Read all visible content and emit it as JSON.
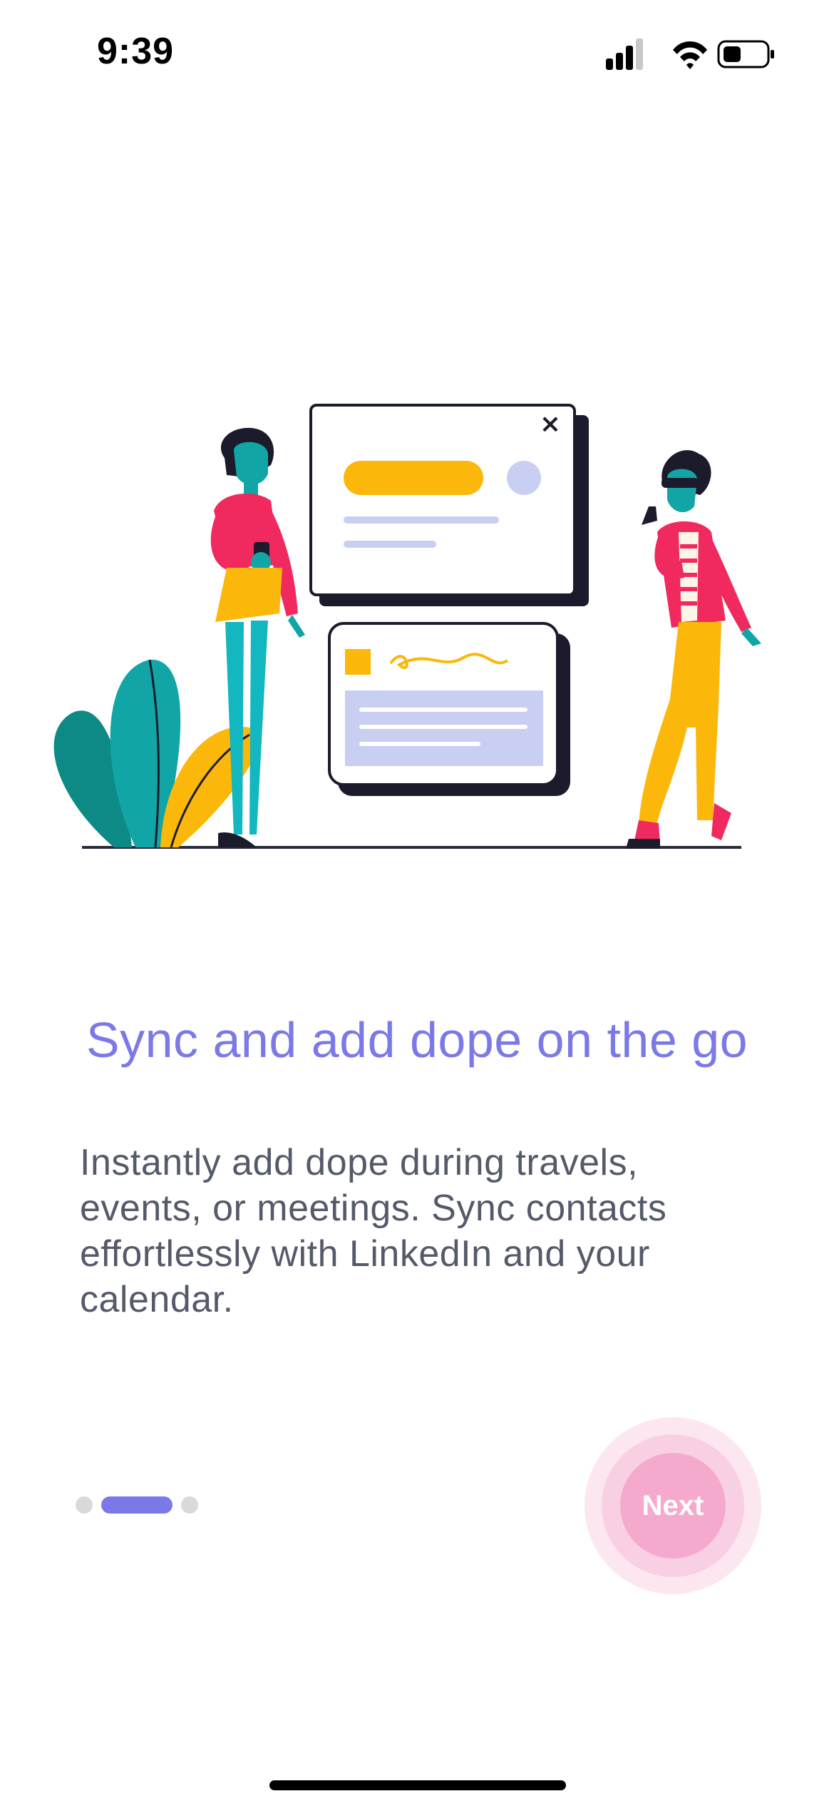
{
  "status_bar": {
    "time": "9:39",
    "icons": [
      "signal-icon",
      "wifi-icon",
      "battery-icon"
    ]
  },
  "illustration": {
    "name": "onboarding-illustration",
    "close_glyph": "×",
    "colors": {
      "pink": "#f0295f",
      "yellow": "#fbb80a",
      "teal": "#11b7c0",
      "dark_teal": "#0d7f80",
      "lavender": "#c8cff3",
      "outline": "#1c1b2b"
    }
  },
  "content": {
    "title": "Sync and add dope on the go",
    "description": "Instantly add dope during travels, events, or meetings. Sync contacts effortlessly with LinkedIn and your calendar."
  },
  "pager": {
    "total": 3,
    "active_index": 1
  },
  "actions": {
    "next_label": "Next"
  },
  "colors": {
    "accent": "#7b79e8",
    "next_button": "#f5a9cc",
    "body_text": "#555a6a"
  }
}
